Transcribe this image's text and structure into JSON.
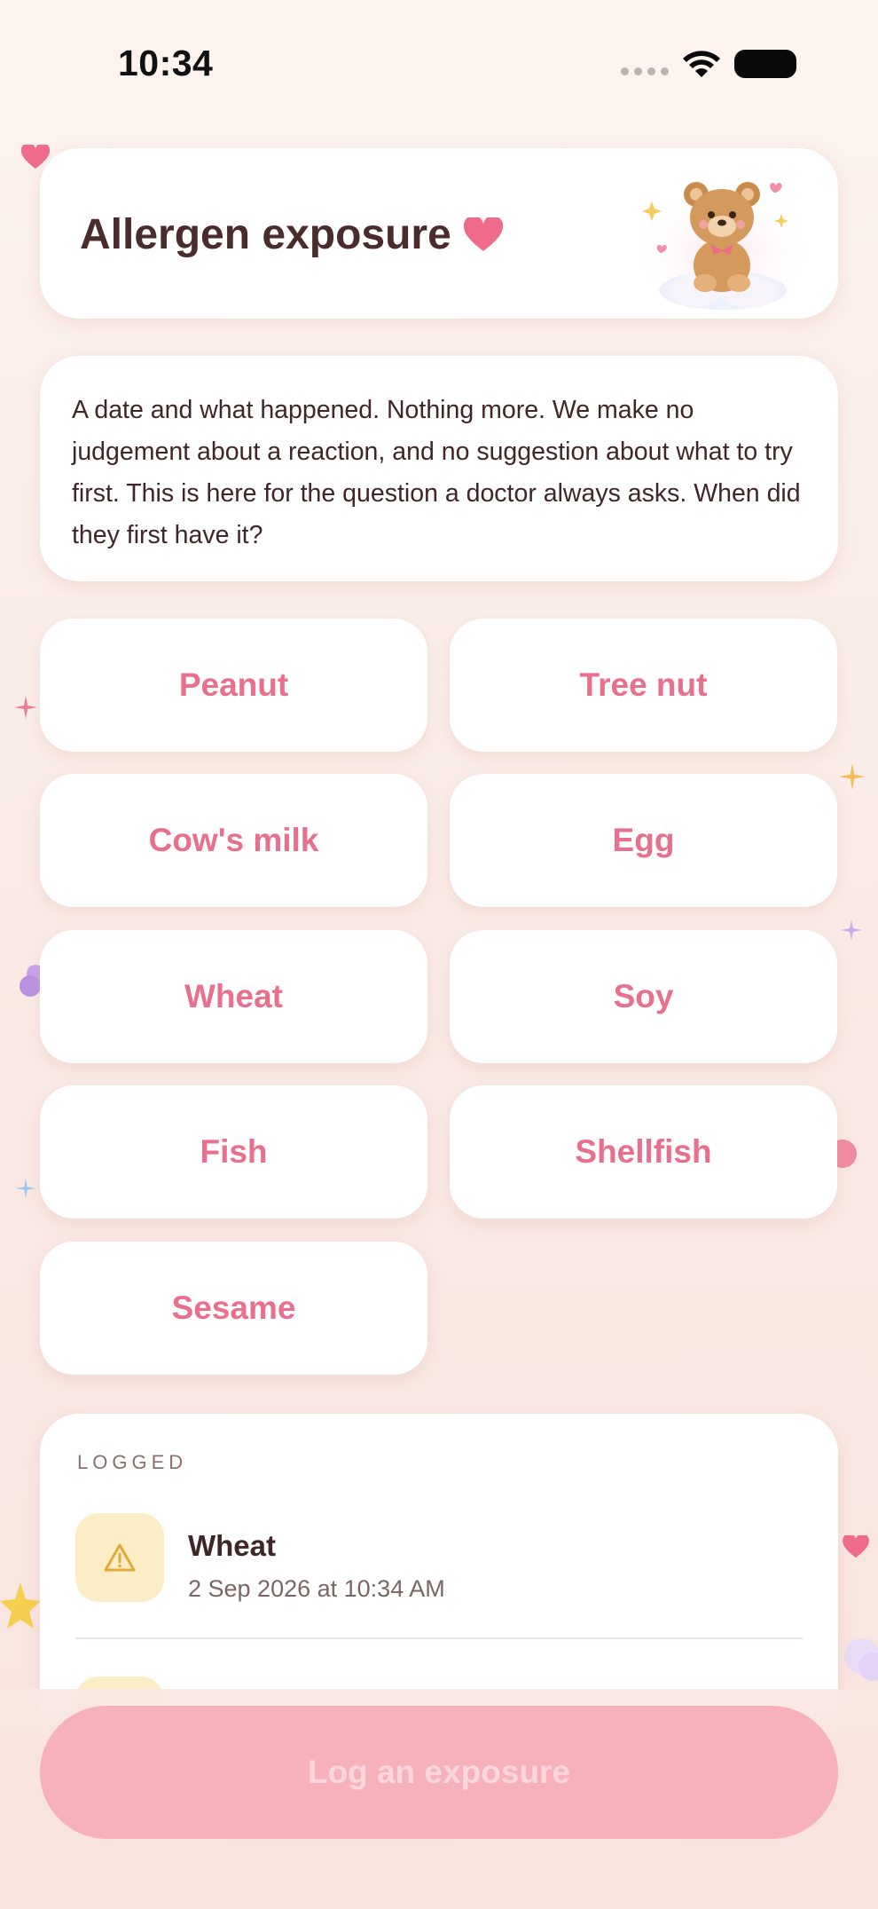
{
  "status_bar": {
    "time": "10:34"
  },
  "header": {
    "title": "Allergen exposure"
  },
  "intro": {
    "text": "A date and what happened. Nothing more. We make no judgement about a reaction, and no suggestion about what to try first. This is here for the question a doctor always asks. When did they first have it?"
  },
  "allergens": [
    "Peanut",
    "Tree nut",
    "Cow's milk",
    "Egg",
    "Wheat",
    "Soy",
    "Fish",
    "Shellfish",
    "Sesame"
  ],
  "logged": {
    "label": "LOGGED",
    "items": [
      {
        "name": "Wheat",
        "date": "2 Sep 2026 at 10:34 AM",
        "icon": "warning-icon"
      }
    ]
  },
  "primary_action": {
    "label": "Log an exposure"
  },
  "colors": {
    "accent_pink": "#e8708e",
    "button_disabled": "#f7b1ba",
    "warning_bg": "#fbeec6",
    "warning_icon": "#e0a93a"
  }
}
